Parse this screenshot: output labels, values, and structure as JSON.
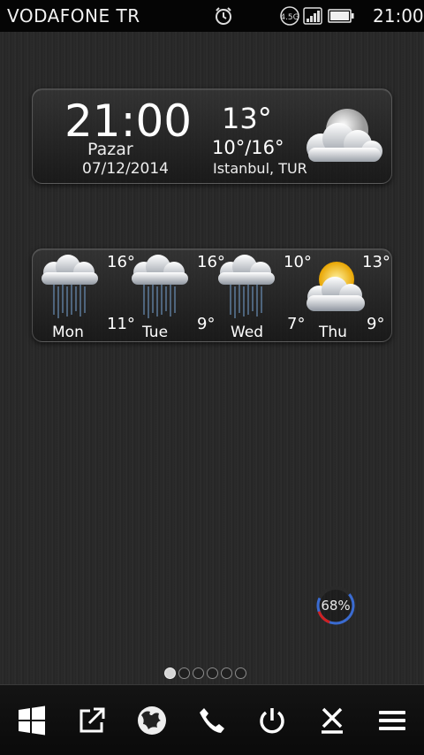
{
  "status_bar": {
    "carrier": "VODAFONE TR",
    "network_badge": "4.5G",
    "time": "21:00",
    "icons": [
      "alarm-clock-icon",
      "network-4.5g-icon",
      "signal-icon",
      "battery-icon"
    ]
  },
  "clock_widget": {
    "time": "21:00",
    "day": "Pazar",
    "date": "07/12/2014",
    "current_temp": "13°",
    "temp_range": "10°/16°",
    "city": "Istanbul, TUR",
    "condition_icon": "cloudy-night-icon"
  },
  "forecast": [
    {
      "day": "Mon",
      "high": "16°",
      "low": "11°",
      "icon": "rain-icon"
    },
    {
      "day": "Tue",
      "high": "16°",
      "low": "9°",
      "icon": "rain-icon"
    },
    {
      "day": "Wed",
      "high": "10°",
      "low": "7°",
      "icon": "rain-icon"
    },
    {
      "day": "Thu",
      "high": "13°",
      "low": "9°",
      "icon": "partly-cloudy-icon"
    }
  ],
  "battery_ring": {
    "label": "68%",
    "level": 0.68,
    "colors": {
      "fill": "#3a6bd1",
      "low": "#d02020"
    }
  },
  "home_pages": {
    "count": 6,
    "active": 1
  },
  "dock": [
    "windows-icon",
    "share-icon",
    "europe-map-icon",
    "phone-icon",
    "power-icon",
    "close-icon",
    "menu-icon"
  ]
}
